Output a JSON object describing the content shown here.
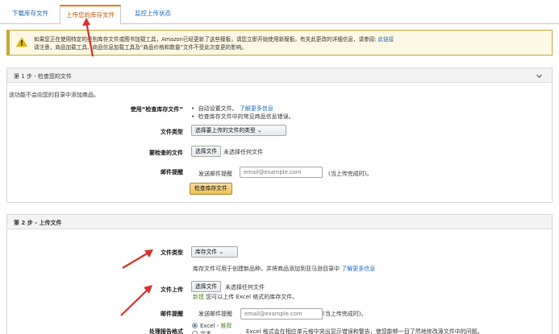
{
  "tabs": [
    {
      "label": "下载库存文件",
      "active": false
    },
    {
      "label": "上传您的库存文件",
      "active": true
    },
    {
      "label": "监控上传状态",
      "active": false
    }
  ],
  "alert": {
    "text": "如果您正在使用特定的类别库存文件或图书加载工具，Amazon已经更新了这些模板，请您立即开始使用新模板。有关此更改的详细信息，请参阅:",
    "link": "此链接",
    "text2": "请注意，商品加载工具、商品信息加载工具及“商品价格和数量”文件不受此次变更的影响。"
  },
  "step1": {
    "title": "第 1 步 - 检查您的文件",
    "intro": "该功能不会向您的目录中添加商品。",
    "use_label": "使用“检查库存文件”",
    "bullets": [
      "自动设置文件。",
      "检查库存文件中的常见商品信息错误。"
    ],
    "learn_more": "了解更多信息",
    "file_type_label": "文件类型",
    "file_type_select": "选择要上传的文件的类型",
    "file_label": "要检查的文件",
    "choose_file_btn": "选择文件",
    "no_file": "未选择任何文件",
    "email_label": "邮件提醒",
    "email_send": "发送邮件提醒",
    "email_placeholder": "email@example.com",
    "email_note": "(当上传完成时)。",
    "check_btn": "检查库存文件"
  },
  "step2": {
    "title": "第 2 步 - 上传文件",
    "file_type_label": "文件类型",
    "file_type_select": "库存文件",
    "file_type_desc": "库存文件可用于创建新品种，并将商品添加到亚马逊目录中",
    "learn_more": "了解更多信息",
    "upload_label": "文件上传",
    "choose_file_btn": "选择文件",
    "no_file": "未选择任何文件",
    "new_badge": "新建",
    "excel_note": "您可以上传 Excel 格式的库存文件。",
    "email_label": "邮件提醒",
    "email_send": "发送邮件提醒",
    "email_placeholder": "email@example.com",
    "email_note": "(当上传完成时)。",
    "report_label": "处理报告格式",
    "radio_excel": "Excel -",
    "recommended": "推荐",
    "radio_text": "文本",
    "excel_desc": "Excel 格式会在相应单元格中突出显示错误和警告，使您能够一目了然地修改源文件中的问题。"
  },
  "colors": {
    "accent": "#e77600",
    "link": "#1d69b5",
    "arrow": "#d9302a",
    "button": "#f0c14b"
  }
}
